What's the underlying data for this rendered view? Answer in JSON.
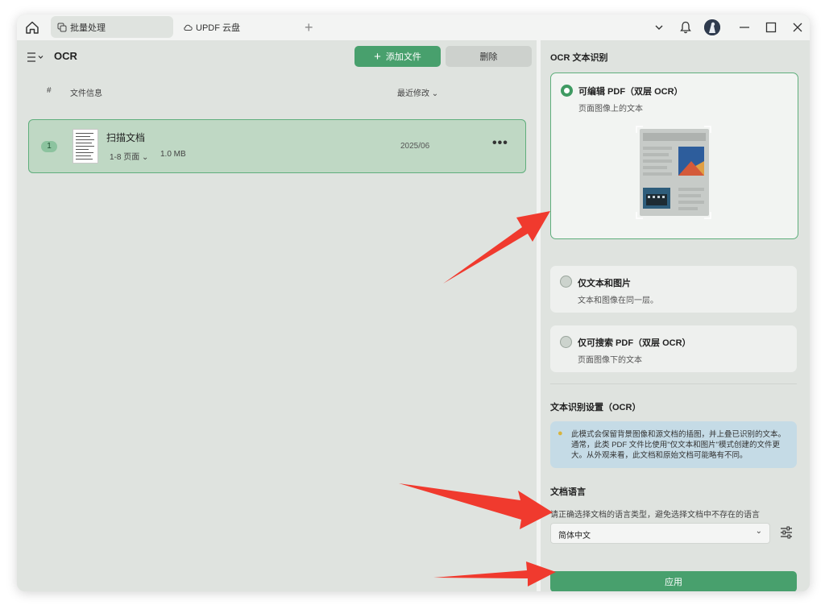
{
  "titlebar": {
    "tabs": [
      {
        "label": "批量处理",
        "icon": "batch-icon",
        "active": true
      },
      {
        "label": "UPDF 云盘",
        "icon": "cloud-icon",
        "active": false
      }
    ],
    "add_tab": "+"
  },
  "left_panel": {
    "title": "OCR",
    "add_button": "添加文件",
    "delete_button": "删除",
    "columns": {
      "index": "#",
      "info": "文件信息",
      "modified": "最近修改"
    },
    "files": [
      {
        "index": "1",
        "name": "扫描文档",
        "pages": "1-8 页面",
        "size": "1.0 MB",
        "date": "2025/06",
        "more": "•••"
      }
    ]
  },
  "right_panel": {
    "section_ocr": "OCR 文本识别",
    "options": [
      {
        "title": "可编辑 PDF（双层 OCR）",
        "desc": "页面图像上的文本",
        "selected": true
      },
      {
        "title": "仅文本和图片",
        "desc": "文本和图像在同一层。",
        "selected": false
      },
      {
        "title": "仅可搜索 PDF（双层 OCR）",
        "desc": "页面图像下的文本",
        "selected": false
      }
    ],
    "settings_title": "文本识别设置（OCR）",
    "info_text": "此模式会保留背景图像和源文档的插图，并上叠已识别的文本。通常，此类 PDF 文件比使用\"仅文本和图片\"模式创建的文件更大。从外观来看，此文档和原始文档可能略有不同。",
    "language_title": "文档语言",
    "language_hint": "请正确选择文档的语言类型，避免选择文档中不存在的语言",
    "language_value": "简体中文",
    "apply_button": "应用"
  },
  "colors": {
    "accent": "#48a06d",
    "arrow": "#f03a2e",
    "background": "#dfe3df",
    "selected_row": "#bfd8c4",
    "info_box": "#c5dbe6"
  }
}
